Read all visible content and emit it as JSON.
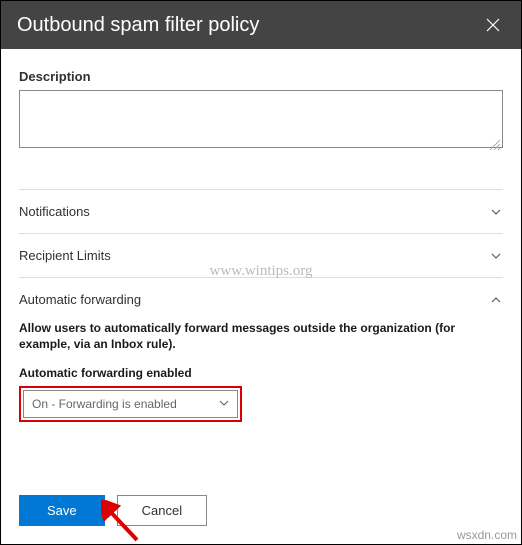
{
  "header": {
    "title": "Outbound spam filter policy"
  },
  "description": {
    "label": "Description",
    "value": ""
  },
  "sections": {
    "notifications": {
      "title": "Notifications"
    },
    "recipientLimits": {
      "title": "Recipient Limits"
    },
    "autoForwarding": {
      "title": "Automatic forwarding",
      "helpText": "Allow users to automatically forward messages outside the organization (for example, via an Inbox rule).",
      "subLabel": "Automatic forwarding enabled",
      "selected": "On - Forwarding is enabled"
    }
  },
  "footer": {
    "save": "Save",
    "cancel": "Cancel"
  },
  "watermark": "www.wintips.org",
  "domain": "wsxdn.com"
}
